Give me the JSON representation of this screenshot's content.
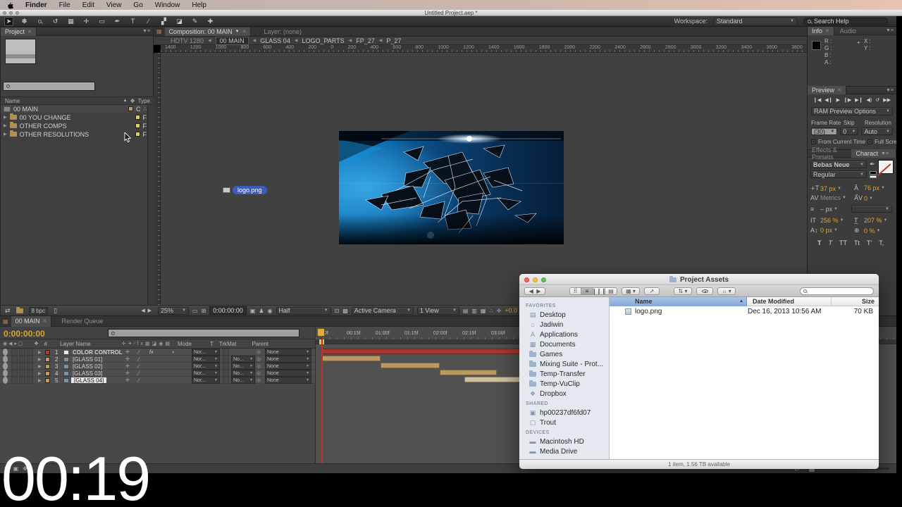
{
  "menu_bar": {
    "app": "Finder",
    "items": [
      "File",
      "Edit",
      "View",
      "Go",
      "Window",
      "Help"
    ]
  },
  "ae": {
    "window_title": "Untitled Project.aep *",
    "toolbar": {
      "workspace_label": "Workspace:",
      "workspace_value": "Standard",
      "search_help": "Search Help"
    },
    "project": {
      "tab": "Project",
      "name_col": "Name",
      "type_col": "Type",
      "items": [
        {
          "name": "00 MAIN",
          "type": "C"
        },
        {
          "name": "00 YOU CHANGE",
          "type": "F"
        },
        {
          "name": "OTHER COMPS",
          "type": "F"
        },
        {
          "name": "OTHER RESOLUTIONS",
          "type": "F"
        }
      ],
      "bpc": "8 bpc"
    },
    "viewer": {
      "comp_tab": "Composition: 00 MAIN",
      "layer_tab": "Layer: (none)",
      "breadcrumb": [
        "HDTV 1280",
        "00 MAIN",
        "GLASS 04",
        "LOGO_PARTS",
        "FP_27",
        "P_27"
      ],
      "hruler": [
        "1400",
        "1200",
        "1000",
        "800",
        "600",
        "400",
        "200",
        "0",
        "200",
        "400",
        "600",
        "800",
        "1000",
        "1200",
        "1400",
        "1600",
        "1800",
        "2000",
        "2200",
        "2400",
        "2600",
        "2800",
        "3000",
        "3200",
        "3400",
        "3600",
        "3800"
      ],
      "drag_label": "logo.png",
      "bar": {
        "zoom": "25%",
        "timecode": "0:00:00:00",
        "resolution": "Half",
        "camera": "Active Camera",
        "view": "1 View",
        "exposure": "+0.0"
      }
    },
    "info": {
      "tab_info": "Info",
      "tab_audio": "Audio",
      "r": "R :",
      "g": "G :",
      "b": "B :",
      "a": "A :",
      "x": "X :",
      "y": "Y :"
    },
    "preview": {
      "tab": "Preview",
      "ram_options": "RAM Preview Options",
      "frame_rate_label": "Frame Rate",
      "frame_rate": "(30)",
      "skip_label": "Skip",
      "skip": "0",
      "resolution_label": "Resolution",
      "resolution": "Auto",
      "from_current_time": "From Current Time",
      "full_screen": "Full Screen"
    },
    "effects_tab": "Effects & Presets",
    "character": {
      "tab": "Charact",
      "font": "Bebas Neue",
      "style": "Regular",
      "size": "37 px",
      "leading": "76 px",
      "kerning": "Metrics",
      "tracking": "0",
      "stroke": "– px",
      "vscale": "256 %",
      "hscale": "207 %",
      "baseline": "0 px",
      "tsume": "0 %",
      "type_buttons": [
        "T",
        "T",
        "TT",
        "Tt",
        "T'",
        "T,"
      ]
    },
    "right_edge_value": "0 px",
    "timeline": {
      "tab_main": "00 MAIN",
      "tab_rq": "Render Queue",
      "timecode": "0:00:00:00",
      "cols": {
        "layer_name": "Layer Name",
        "mode": "Mode",
        "t": "T",
        "trkmat": "TrkMat",
        "parent": "Parent"
      },
      "ruler": [
        "0f",
        "00:15f",
        "01:00f",
        "01:15f",
        "02:00f",
        "02:15f",
        "03:00f"
      ],
      "layers": [
        {
          "num": "1",
          "name": "COLOR CONTROL",
          "mode": "Nor...",
          "trkmat": "",
          "parent": "None"
        },
        {
          "num": "2",
          "name": "[GLASS 01]",
          "mode": "Nor...",
          "trkmat": "No...",
          "parent": "None"
        },
        {
          "num": "3",
          "name": "[GLASS 02]",
          "mode": "Nor...",
          "trkmat": "No...",
          "parent": "None"
        },
        {
          "num": "4",
          "name": "[GLASS 03]",
          "mode": "Nor...",
          "trkmat": "No...",
          "parent": "None"
        },
        {
          "num": "5",
          "name": "[GLASS 04]",
          "mode": "Nor...",
          "trkmat": "No...",
          "parent": "None"
        }
      ]
    }
  },
  "finder": {
    "title": "Project Assets",
    "columns": [
      "Name",
      "Date Modified",
      "Size"
    ],
    "sidebar": {
      "favorites_header": "FAVORITES",
      "favorites": [
        "Desktop",
        "Jadiwin",
        "Applications",
        "Documents",
        "Games",
        "Mixing Suite - Prot...",
        "Temp-Transfer",
        "Temp-VuClip",
        "Dropbox"
      ],
      "shared_header": "SHARED",
      "shared": [
        "hp00237df6fd07",
        "Trout"
      ],
      "devices_header": "DEVICES",
      "devices": [
        "Macintosh HD",
        "Media Drive"
      ]
    },
    "files": [
      {
        "name": "logo.png",
        "modified": "Dec 16, 2013 10:56 AM",
        "size": "70 KB"
      }
    ],
    "status": "1 item, 1.56 TB available"
  },
  "overlay": {
    "timer": "00:19"
  },
  "colors": {
    "accent_orange": "#d9a43c",
    "label_red": "#b23a32",
    "label_tan": "#c19a60",
    "label_yellow": "#ddd04e",
    "timeline_red_bar": "#a8382e",
    "comp_blue": "#0a5a94"
  }
}
